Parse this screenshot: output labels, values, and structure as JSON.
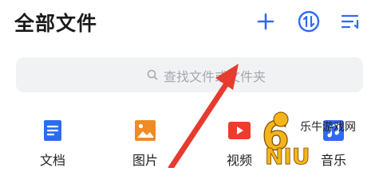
{
  "header": {
    "title": "全部文件",
    "icons": [
      "add-icon",
      "transfer-icon",
      "sort-icon"
    ]
  },
  "search": {
    "placeholder": "查找文件或文件夹",
    "icon": "search-icon"
  },
  "categories": [
    {
      "label": "文档",
      "icon": "document-icon",
      "color": "#2f6bf2"
    },
    {
      "label": "图片",
      "icon": "image-icon",
      "color": "#f08a24"
    },
    {
      "label": "视频",
      "icon": "video-icon",
      "color": "#ee3b2b"
    },
    {
      "label": "音乐",
      "icon": "music-icon",
      "color": "#2f6bf2"
    }
  ],
  "watermark": {
    "text": "乐牛游戏网",
    "logo": "6NIU"
  },
  "colors": {
    "accent": "#2f6bf2",
    "annotation_arrow": "#e63b2e"
  }
}
